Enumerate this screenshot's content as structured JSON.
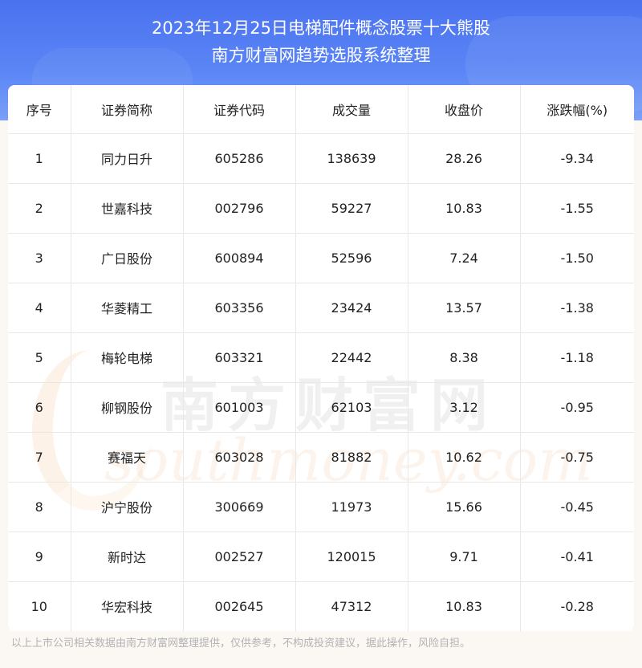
{
  "header": {
    "title_line1": "2023年12月25日电梯配件概念股票十大熊股",
    "title_line2": "南方财富网趋势选股系统整理"
  },
  "watermark": {
    "cn": "南方财富网",
    "en": "southmoney.com"
  },
  "table": {
    "columns": [
      "序号",
      "证券简称",
      "证券代码",
      "成交量",
      "收盘价",
      "涨跌幅(%)"
    ],
    "rows": [
      [
        "1",
        "同力日升",
        "605286",
        "138639",
        "28.26",
        "-9.34"
      ],
      [
        "2",
        "世嘉科技",
        "002796",
        "59227",
        "10.83",
        "-1.55"
      ],
      [
        "3",
        "广日股份",
        "600894",
        "52596",
        "7.24",
        "-1.50"
      ],
      [
        "4",
        "华菱精工",
        "603356",
        "23424",
        "13.57",
        "-1.38"
      ],
      [
        "5",
        "梅轮电梯",
        "603321",
        "22442",
        "8.38",
        "-1.18"
      ],
      [
        "6",
        "柳钢股份",
        "601003",
        "62103",
        "3.12",
        "-0.95"
      ],
      [
        "7",
        "赛福天",
        "603028",
        "81882",
        "10.62",
        "-0.75"
      ],
      [
        "8",
        "沪宁股份",
        "300669",
        "11973",
        "15.66",
        "-0.45"
      ],
      [
        "9",
        "新时达",
        "002527",
        "120015",
        "9.71",
        "-0.41"
      ],
      [
        "10",
        "华宏科技",
        "002645",
        "47312",
        "10.83",
        "-0.28"
      ]
    ]
  },
  "footer": {
    "disclaimer": "以上上市公司相关数据由南方财富网整理提供，仅供参考，不构成投资建议，据此操作，风险自担。"
  }
}
